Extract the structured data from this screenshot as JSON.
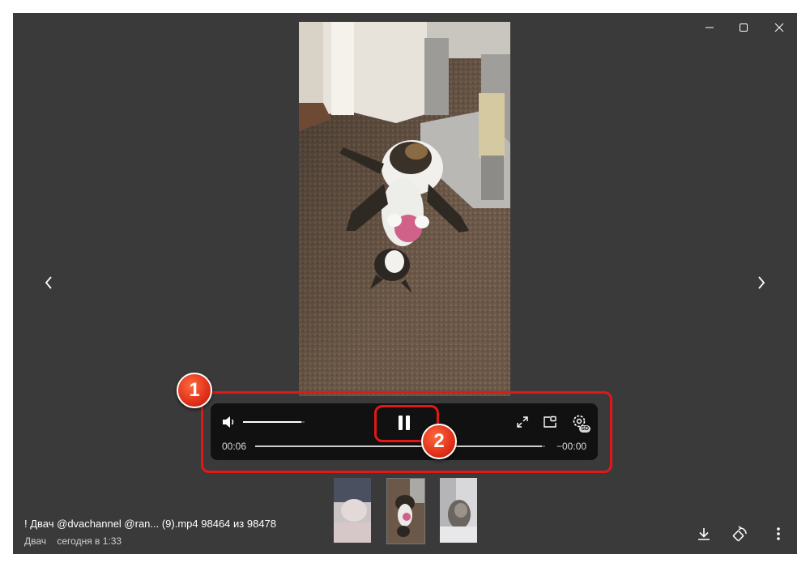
{
  "window": {
    "controls": [
      "minimize",
      "maximize",
      "close"
    ]
  },
  "player": {
    "current_time": "00:06",
    "remaining_time": "−00:00",
    "progress": 0.99,
    "volume": 0.95,
    "settings_badge": "SD",
    "state": "playing"
  },
  "markers": {
    "one": "1",
    "two": "2"
  },
  "thumbnails": [
    {
      "name": "thumbnail-1"
    },
    {
      "name": "thumbnail-2-current"
    },
    {
      "name": "thumbnail-3"
    }
  ],
  "caption": {
    "title": "! Двач @dvachannel @ran... (9).mp4 98464 из 98478",
    "author": "Двач",
    "date": "сегодня в 1:33"
  },
  "colors": {
    "window_bg": "#3a3a3a",
    "controls_bg": "#111111",
    "highlight": "#e01818"
  }
}
